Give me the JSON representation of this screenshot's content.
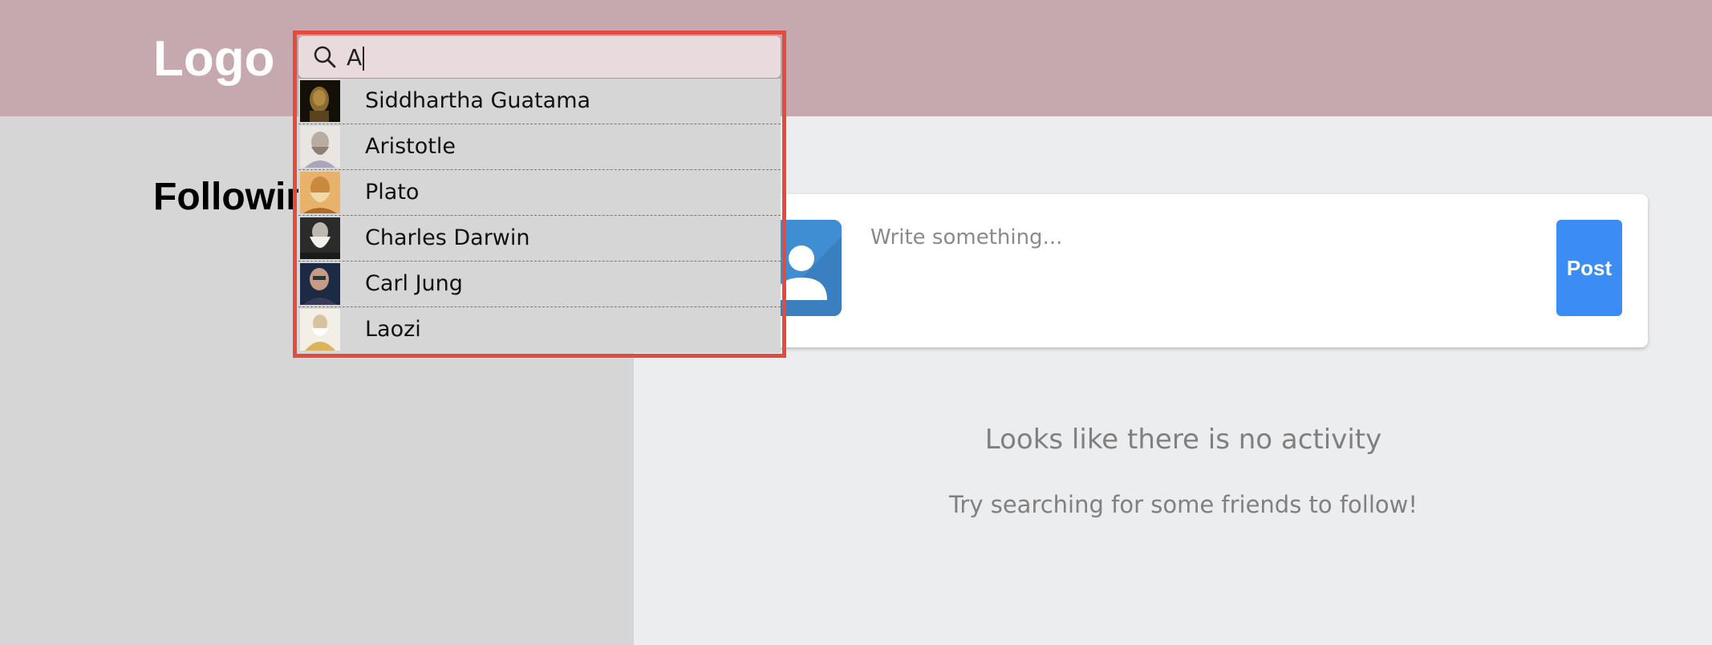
{
  "header": {
    "logo": "Logo",
    "background": "#c6a9ae"
  },
  "sidebar": {
    "title": "Following"
  },
  "search": {
    "value": "A",
    "icon": "search-icon",
    "highlight_color": "#e54b3c",
    "results": [
      {
        "name": "Siddhartha Guatama",
        "avatar": "buddha-portrait"
      },
      {
        "name": "Aristotle",
        "avatar": "aristotle-portrait"
      },
      {
        "name": "Plato",
        "avatar": "plato-portrait"
      },
      {
        "name": "Charles Darwin",
        "avatar": "darwin-portrait"
      },
      {
        "name": "Carl Jung",
        "avatar": "jung-portrait"
      },
      {
        "name": "Laozi",
        "avatar": "laozi-portrait"
      }
    ]
  },
  "composer": {
    "placeholder": "Write something...",
    "post_label": "Post",
    "post_color": "#3b8cf5",
    "avatar_icon": "user-avatar-icon"
  },
  "feed": {
    "empty_title": "Looks like there is no activity",
    "empty_subtitle": "Try searching for some friends to follow!"
  }
}
